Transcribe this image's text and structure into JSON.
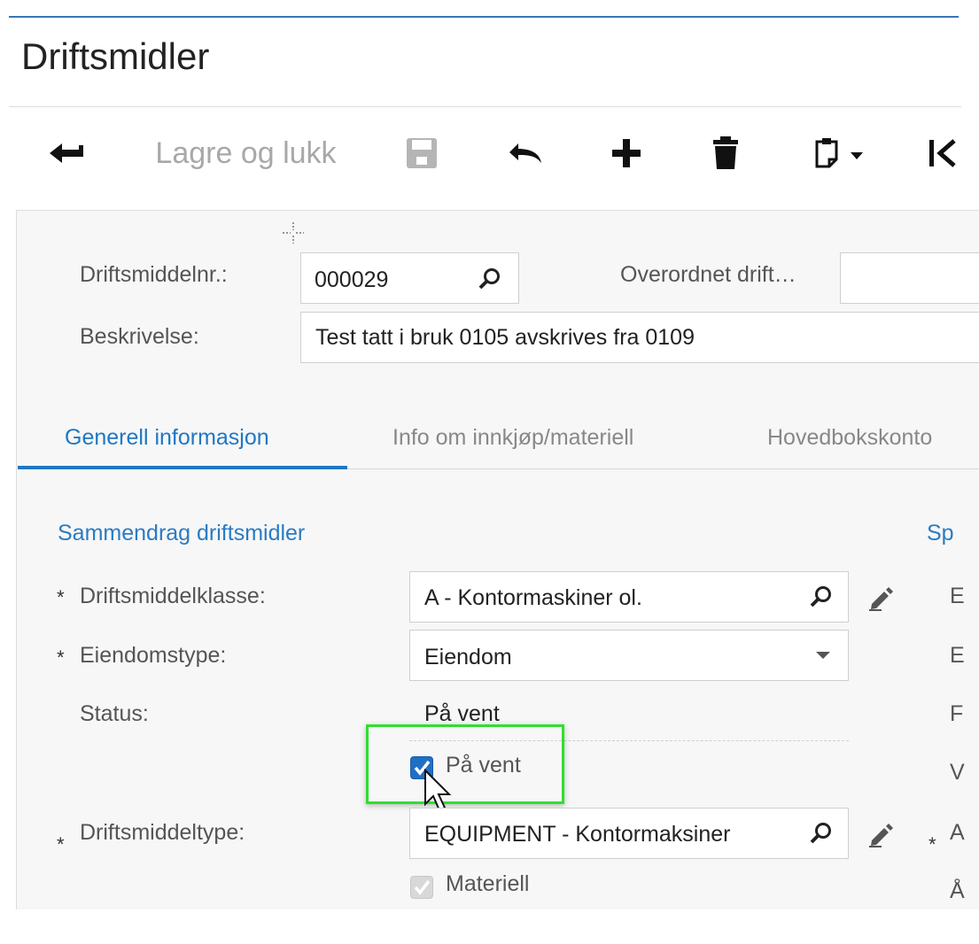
{
  "page": {
    "title": "Driftsmidler"
  },
  "toolbar": {
    "back_icon": "arrow-left-icon",
    "save_close_label": "Lagre og lukk",
    "save_icon": "floppy-disk-icon",
    "undo_icon": "undo-icon",
    "add_icon": "plus-icon",
    "delete_icon": "trash-icon",
    "clipboard_icon": "clipboard-dropdown-icon",
    "first_icon": "first-record-icon"
  },
  "header": {
    "asset_no_label": "Driftsmiddelnr.:",
    "asset_no_value": "000029",
    "parent_label": "Overordnet drift…",
    "parent_value": "",
    "description_label": "Beskrivelse:",
    "description_value": "Test tatt i bruk 0105 avskrives fra 0109"
  },
  "tabs": [
    {
      "label": "Generell informasjon",
      "active": true
    },
    {
      "label": "Info om innkjøp/materiell",
      "active": false
    },
    {
      "label": "Hovedbokskonto",
      "active": false
    }
  ],
  "summary": {
    "section_title": "Sammendrag driftsmidler",
    "required_marker": "*",
    "class_label": "Driftsmiddelklasse:",
    "class_value": "A - Kontormaskiner ol.",
    "property_type_label": "Eiendomstype:",
    "property_type_value": "Eiendom",
    "status_label": "Status:",
    "status_value": "På vent",
    "on_hold_label": "På vent",
    "on_hold_checked": true,
    "asset_type_label": "Driftsmiddeltype:",
    "asset_type_value": "EQUIPMENT - Kontormaksiner",
    "material_label": "Materiell",
    "material_checked": true
  },
  "right_column": {
    "section_title": "Sp",
    "letters": [
      "E",
      "E",
      "F",
      "V",
      "A",
      "Å"
    ],
    "required_marker": "*"
  },
  "colors": {
    "accent": "#1f77c5",
    "highlight": "#2ee02e",
    "checkbox": "#1f6fc5"
  }
}
